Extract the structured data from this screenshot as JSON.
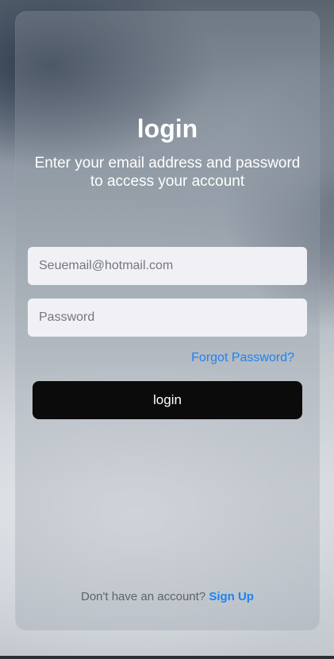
{
  "login": {
    "title": "login",
    "subtitle": "Enter your email address and password to access your account",
    "email_placeholder": "Seuemail@hotmail.com",
    "password_placeholder": "Password",
    "forgot_password_label": "Forgot Password?",
    "submit_label": "login",
    "signup_prompt": "Don't have an account?",
    "signup_link_label": "Sign Up"
  },
  "colors": {
    "link": "#1d84f0",
    "button_background": "#0b0b0c",
    "input_background": "#f1f1f5"
  }
}
